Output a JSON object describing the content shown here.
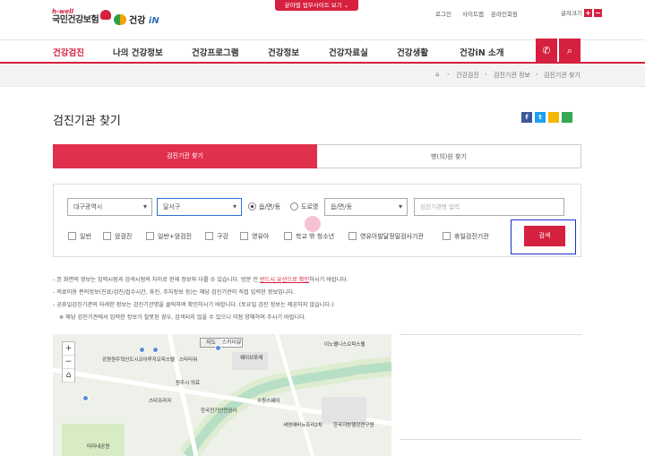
{
  "header": {
    "logo_hwell": "h-well",
    "logo_nhis": "국민건강보험",
    "logo_healthin_prefix": "건강",
    "logo_healthin_suffix": "iN",
    "site_button": "분야별 업무사이트 보기",
    "util_links": [
      "로그인",
      "사이트맵",
      "온라인회원"
    ],
    "font_label": "글자크기",
    "font_plus": "+",
    "font_minus": "−"
  },
  "nav": {
    "items": [
      "건강검진",
      "나의 건강정보",
      "건강프로그램",
      "건강정보",
      "건강자료실",
      "건강생활",
      "건강iN 소개"
    ],
    "phone_icon": "phone-icon",
    "search_icon": "search-icon"
  },
  "breadcrumb": {
    "home_icon": "home-icon",
    "items": [
      "건강검진",
      "검진기관 정보",
      "검진기관 찾기"
    ]
  },
  "page": {
    "title": "검진기관 찾기",
    "share": [
      "f",
      "t",
      "",
      ""
    ]
  },
  "tabs": [
    "검진기관 찾기",
    "병(의)원 찾기"
  ],
  "filter": {
    "city": "대구광역시",
    "district": "달서구",
    "radio1": "읍/면/동",
    "radio2": "도로명",
    "dong": "읍/면/동",
    "name_placeholder": "검진기관명 입력",
    "checkboxes": [
      "일반",
      "암검진",
      "일반+암검진",
      "구강",
      "영유아",
      "학교 밖 청소년",
      "영유아발달정밀검사기관",
      "휴일검진기관"
    ],
    "search_button": "검색"
  },
  "notes": {
    "n1_pre": "- 본 화면의 정보는 입력시점과 검색시점의 차이로 현재 정보와 다를 수 있습니다.  방문 전 ",
    "n1_red": "반드시 유선으로 확인",
    "n1_post": "하시기 바랍니다.",
    "n2": "- 의료이용 편의정보(진료/검진/접수시간, 휴진, 주차정보 등)는 해당 검진기관이 직접 입력한 정보입니다.",
    "n3": "- 공휴일검진기관의 자세한 정보는 검진기관명을 클릭하여 확인하시기 바랍니다. (토요일 검진 정보는 제공하지 않습니다.)",
    "n4": "※ 해당 검진기관에서 입력한 정보가 잘못된 경우, 검색되지 않을 수 있으니 이점 양해하여 주시기 바랍니다."
  },
  "map": {
    "toggle": [
      "지도",
      "스카이뷰"
    ],
    "zoom": [
      "+",
      "−",
      "⌂"
    ],
    "labels": [
      "이노웰니스오피스텔",
      "강원원주혁신도시코아루지오피스텔",
      "스타타워",
      "웨이브포레",
      "원주시 의료",
      "한국지방행정연구원",
      "미리내공원",
      "스타프라자",
      "수원스웨어",
      "한국전기안전공사",
      "세영에비뉴프리2차"
    ]
  }
}
